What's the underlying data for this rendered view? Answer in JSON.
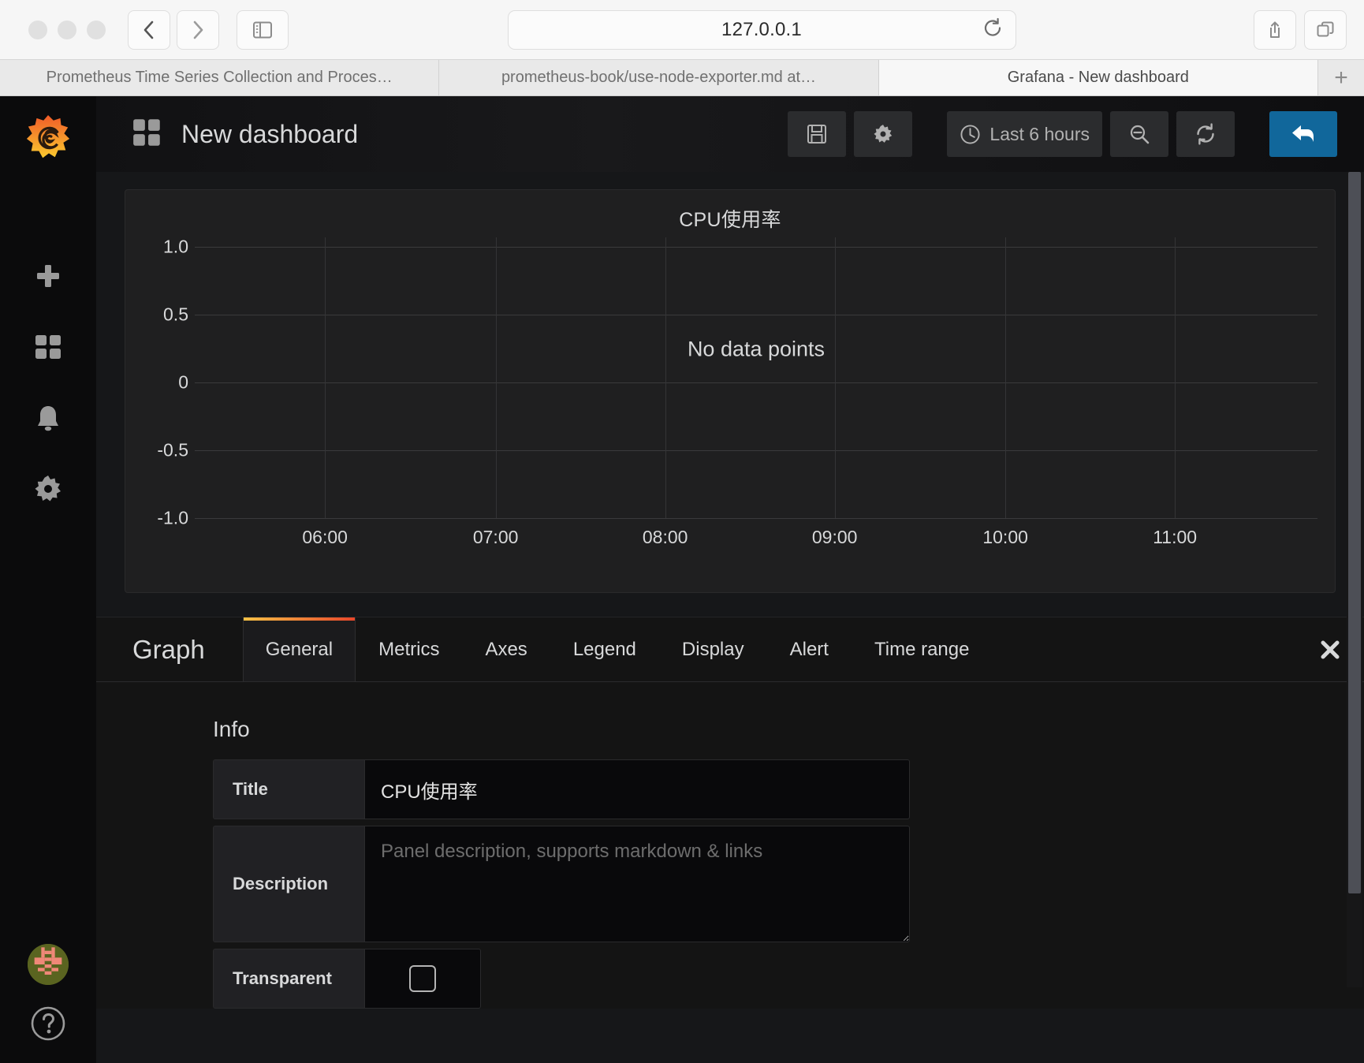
{
  "browser": {
    "address": "127.0.0.1",
    "reload_icon": "reload-icon",
    "back_icon": "chevron-left-icon",
    "forward_icon": "chevron-right-icon",
    "sidebar_icon": "sidebar-toggle-icon",
    "share_icon": "share-icon",
    "tabs_overview_icon": "tab-overview-icon",
    "new_tab_label": "+",
    "tabs": [
      {
        "title": "Prometheus Time Series Collection and Proces…",
        "active": false
      },
      {
        "title": "prometheus-book/use-node-exporter.md at…",
        "active": false
      },
      {
        "title": "Grafana - New dashboard",
        "active": true
      }
    ]
  },
  "sidebar": {
    "logo_name": "grafana-logo",
    "items": [
      {
        "name": "create-add",
        "icon": "plus-icon"
      },
      {
        "name": "dashboards",
        "icon": "dashboards-grid-icon"
      },
      {
        "name": "alerting",
        "icon": "bell-icon"
      },
      {
        "name": "configuration",
        "icon": "gear-icon"
      }
    ],
    "bottom": [
      {
        "name": "user-profile",
        "icon": "avatar-identicon"
      },
      {
        "name": "help",
        "icon": "question-circle-icon"
      }
    ]
  },
  "dashboard": {
    "title": "New dashboard",
    "title_icon": "dashboard-grid-icon",
    "toolbar": {
      "save_icon": "floppy-save-icon",
      "settings_icon": "gear-icon",
      "time_range_label": "Last 6 hours",
      "time_range_icon": "clock-icon",
      "zoom_out_icon": "zoom-out-magnifier-icon",
      "refresh_icon": "refresh-icon",
      "back_label_icon": "back-arrow-icon"
    }
  },
  "panel": {
    "title": "CPU使用率",
    "empty_message": "No data points"
  },
  "chart_data": {
    "type": "line",
    "title": "CPU使用率",
    "xlabel": "",
    "ylabel": "",
    "x_tick_labels": [
      "06:00",
      "07:00",
      "08:00",
      "09:00",
      "10:00",
      "11:00"
    ],
    "y_tick_labels": [
      "1.0",
      "0.5",
      "0",
      "-0.5",
      "-1.0"
    ],
    "y_tick_values": [
      1.0,
      0.5,
      0,
      -0.5,
      -1.0
    ],
    "ylim": [
      -1.0,
      1.0
    ],
    "grid": true,
    "legend": false,
    "series": [],
    "annotation": "No data points"
  },
  "editor": {
    "panel_type_label": "Graph",
    "close_icon": "close-x-icon",
    "tabs": [
      {
        "label": "General",
        "active": true
      },
      {
        "label": "Metrics",
        "active": false
      },
      {
        "label": "Axes",
        "active": false
      },
      {
        "label": "Legend",
        "active": false
      },
      {
        "label": "Display",
        "active": false
      },
      {
        "label": "Alert",
        "active": false
      },
      {
        "label": "Time range",
        "active": false
      }
    ],
    "info": {
      "section_title": "Info",
      "title_label": "Title",
      "title_value": "CPU使用率",
      "description_label": "Description",
      "description_placeholder": "Panel description, supports markdown & links",
      "description_value": "",
      "transparent_label": "Transparent",
      "transparent_checked": false
    }
  },
  "colors": {
    "accent_blue": "#11679b",
    "tab_gradient_start": "#f5c145",
    "tab_gradient_end": "#e8472a",
    "panel_bg": "#1f1f20",
    "app_bg": "#161719",
    "sidebar_bg": "#0b0b0c"
  }
}
